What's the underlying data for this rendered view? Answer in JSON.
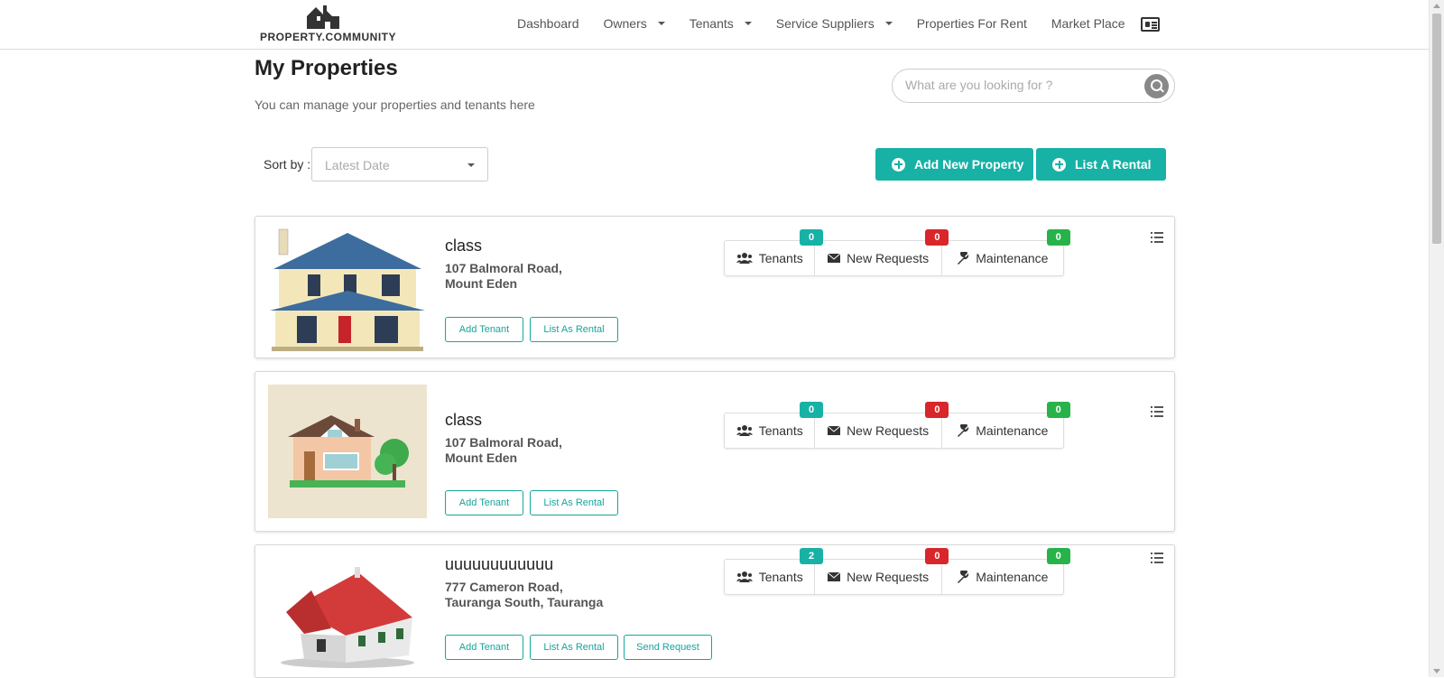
{
  "brand": {
    "name": "PROPERTY.COMMUNITY"
  },
  "nav": {
    "items": [
      {
        "label": "Dashboard",
        "dropdown": false
      },
      {
        "label": "Owners",
        "dropdown": true
      },
      {
        "label": "Tenants",
        "dropdown": true
      },
      {
        "label": "Service Suppliers",
        "dropdown": true
      },
      {
        "label": "Properties For Rent",
        "dropdown": false
      },
      {
        "label": "Market Place",
        "dropdown": false
      }
    ],
    "profile_icon": "id-card-icon"
  },
  "page": {
    "title": "My Properties",
    "subtitle": "You can manage your properties and tenants here"
  },
  "search": {
    "placeholder": "What are you looking for ?",
    "icon": "search-icon"
  },
  "sort": {
    "label": "Sort by :",
    "selected": "Latest Date"
  },
  "actions": {
    "add_property": "Add New Property",
    "list_rental": "List A Rental"
  },
  "colors": {
    "accent": "#17b1a6",
    "red": "#d9262a",
    "green": "#27b34a"
  },
  "properties": [
    {
      "name": "class",
      "address_line1": "107 Balmoral Road,",
      "address_line2": "Mount Eden",
      "image": "blue-roof-house-illustration",
      "buttons": [
        "Add Tenant",
        "List As Rental"
      ],
      "stats": {
        "tenants_label": "Tenants",
        "tenants": "0",
        "requests_label": "New Requests",
        "requests": "0",
        "maintenance_label": "Maintenance",
        "maintenance": "0"
      }
    },
    {
      "name": "class",
      "address_line1": "107 Balmoral Road,",
      "address_line2": "Mount Eden",
      "image": "flat-house-with-tree-illustration",
      "buttons": [
        "Add Tenant",
        "List As Rental"
      ],
      "stats": {
        "tenants_label": "Tenants",
        "tenants": "0",
        "requests_label": "New Requests",
        "requests": "0",
        "maintenance_label": "Maintenance",
        "maintenance": "0"
      }
    },
    {
      "name": "uuuuuuuuuuuu",
      "address_line1": "777 Cameron Road,",
      "address_line2": "Tauranga South, Tauranga",
      "image": "red-roof-house-3d",
      "buttons": [
        "Add Tenant",
        "List As Rental",
        "Send Request"
      ],
      "stats": {
        "tenants_label": "Tenants",
        "tenants": "2",
        "requests_label": "New Requests",
        "requests": "0",
        "maintenance_label": "Maintenance",
        "maintenance": "0"
      }
    }
  ]
}
